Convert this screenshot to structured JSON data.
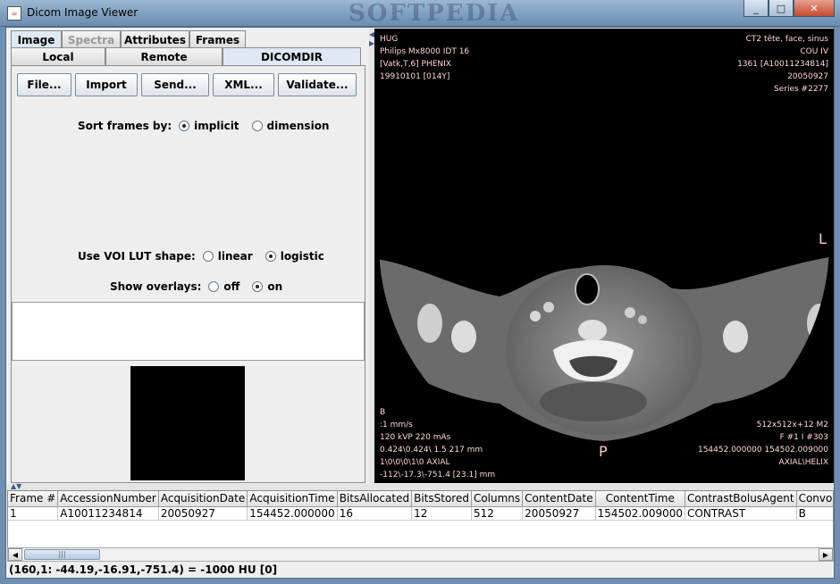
{
  "window": {
    "title": "Dicom Image Viewer",
    "watermark": "SOFTPEDIA",
    "minimize": "_",
    "maximize": "□",
    "close": "✕"
  },
  "tabs_top": [
    "Image",
    "Spectra",
    "Attributes",
    "Frames"
  ],
  "tabs_bottom": [
    "Local",
    "Remote",
    "DICOMDIR"
  ],
  "buttons": {
    "file": "File...",
    "import": "Import",
    "send": "Send...",
    "xml": "XML...",
    "validate": "Validate..."
  },
  "sort": {
    "label": "Sort frames by:",
    "opt1": "implicit",
    "opt2": "dimension",
    "selected": "implicit"
  },
  "voi": {
    "label": "Use VOI LUT shape:",
    "opt1": "linear",
    "opt2": "logistic",
    "selected": "logistic"
  },
  "overlays": {
    "label": "Show overlays:",
    "opt1": "off",
    "opt2": "on",
    "selected": "on"
  },
  "viewer": {
    "top_left": [
      "HUG",
      "Philips Mx8000 IDT 16",
      "[Vatk,T,6] PHENIX",
      " 19910101 [014Y]"
    ],
    "top_right": [
      "CT2 tête, face, sinus",
      "COU IV",
      "1361 [A10011234814]",
      "20050927",
      "Series #2277"
    ],
    "bottom_left": [
      "B",
      " :1  mm/s",
      "120 kVP 220 mAs",
      "0.424\\0.424\\ 1.5 217 mm",
      "1\\0\\0\\0\\1\\0 AXIAL",
      "-112\\-17.3\\-751.4 [23.1] mm"
    ],
    "bottom_right": [
      "512x512x+12 M2",
      "F #1 I #303",
      "154452.000000 154502.009000",
      "AXIAL\\HELIX"
    ],
    "marker_l": "L",
    "marker_p": "P"
  },
  "table": {
    "columns": [
      "Frame #",
      "AccessionNumber",
      "AcquisitionDate",
      "AcquisitionTime",
      "BitsAllocated",
      "BitsStored",
      "Columns",
      "ContentDate",
      "ContentTime",
      "ContrastBolusAgent",
      "Convolu"
    ],
    "rows": [
      [
        "1",
        "A10011234814",
        "20050927",
        "154452.000000",
        "16",
        "12",
        "512",
        "20050927",
        "154502.009000",
        "CONTRAST",
        "B"
      ]
    ]
  },
  "status": "(160,1: -44.19,-16.91,-751.4) = -1000 HU [0]"
}
